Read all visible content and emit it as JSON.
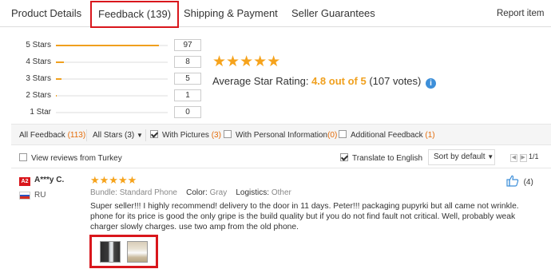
{
  "tabs": [
    {
      "label": "Product Details"
    },
    {
      "label": "Feedback (139)"
    },
    {
      "label": "Shipping & Payment"
    },
    {
      "label": "Seller Guarantees"
    }
  ],
  "report_label": "Report item",
  "distribution": [
    {
      "label": "5 Stars",
      "count": "97",
      "fraction": 0.92
    },
    {
      "label": "4 Stars",
      "count": "8",
      "fraction": 0.07
    },
    {
      "label": "3 Stars",
      "count": "5",
      "fraction": 0.05
    },
    {
      "label": "2 Stars",
      "count": "1",
      "fraction": 0.01
    },
    {
      "label": "1 Star",
      "count": "0",
      "fraction": 0
    }
  ],
  "average": {
    "stars": "★★★★★",
    "prefix": "Average Star Rating:",
    "rating": "4.8 out of 5",
    "votes": "(107 votes)"
  },
  "filters": {
    "all_feedback": "All Feedback",
    "all_feedback_count": "(113)",
    "all_stars": "All Stars (3)",
    "with_pictures": "With Pictures",
    "with_pictures_count": "(3)",
    "with_personal": "With Personal Information",
    "with_personal_count": "(0)",
    "additional": "Additional Feedback",
    "additional_count": "(1)"
  },
  "view_reviews": "View reviews from Turkey",
  "translate": "Translate to English",
  "sort": "Sort by default",
  "pager": "1/1",
  "review": {
    "badge": "A2",
    "user": "A***y C.",
    "country": "RU",
    "stars": "★★★★★",
    "bundle_label": "Bundle:",
    "bundle_value": "Standard Phone",
    "color_label": "Color:",
    "color_value": "Gray",
    "logistics_label": "Logistics:",
    "logistics_value": "Other",
    "text": "Super seller!!! I highly recommend! delivery to the door in 11 days. Peter!!! packaging pupyrki but all came not wrinkle. phone for its price is good the only gripe is the build quality but if you do not find fault not critical. Well, probably weak charger slowly charges. use two amp from the old phone.",
    "likes": "(4)"
  },
  "colors": {
    "accent": "#f0a01e",
    "highlight_border": "#d9161c",
    "info": "#3d8fd9",
    "count": "#e46c0a"
  }
}
